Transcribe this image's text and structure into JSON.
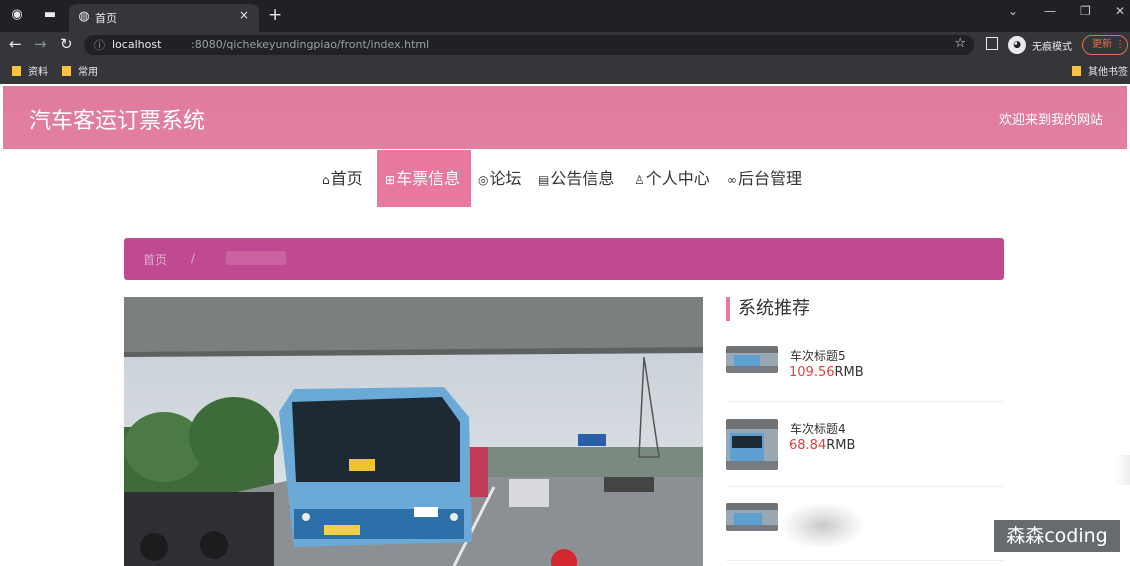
{
  "browser": {
    "tab_title": "首页",
    "tab_close": "×",
    "new_tab": "+",
    "url_host": "localhost",
    "url_rest": ":8080/qichekeyundingpiao/front/index.html",
    "incognito_label": "无痕模式",
    "update_label": "更新",
    "bookmarks": [
      "资料",
      "常用"
    ],
    "other_bookmarks": "其他书签"
  },
  "site": {
    "title": "汽车客运订票系统",
    "welcome": "欢迎来到我的网站"
  },
  "nav": [
    {
      "label": "首页",
      "icon": "home-icon"
    },
    {
      "label": "车票信息",
      "icon": "ticket-icon"
    },
    {
      "label": "论坛",
      "icon": "chat-icon"
    },
    {
      "label": "公告信息",
      "icon": "notice-icon"
    },
    {
      "label": "个人中心",
      "icon": "user-icon"
    },
    {
      "label": "后台管理",
      "icon": "link-icon"
    }
  ],
  "breadcrumb": {
    "home": "首页",
    "separator": "/"
  },
  "sidebar": {
    "title": "系统推荐",
    "items": [
      {
        "name": "车次标题5",
        "price": "109.56",
        "unit": "RMB"
      },
      {
        "name": "车次标题4",
        "price": "68.84",
        "unit": "RMB"
      }
    ]
  },
  "watermark": "森森coding",
  "colors": {
    "header": "#e07b9e",
    "nav_active": "#e8799d",
    "breadcrumb": "#c04a91",
    "price": "#e0413c"
  }
}
